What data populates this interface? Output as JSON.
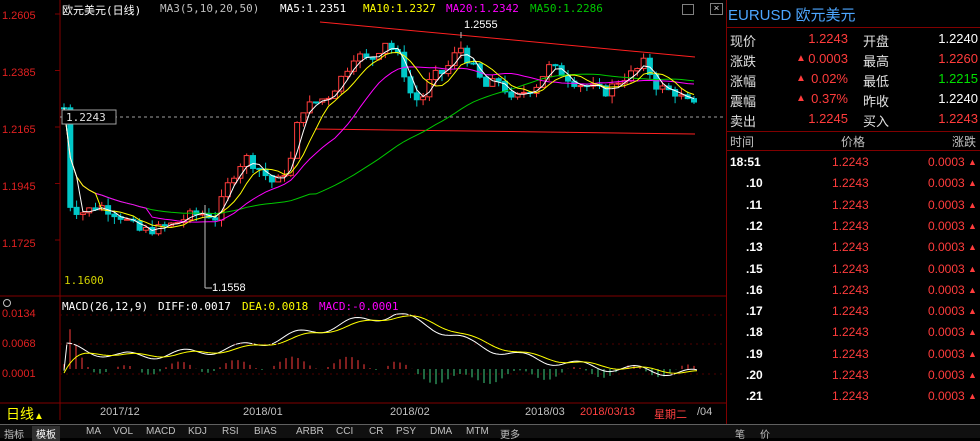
{
  "main_chart": {
    "title": "欧元美元(日线)",
    "ma3": "MA3(5,10,20,50)",
    "ma5": "MA5:1.2351",
    "ma10": "MA10:1.2327",
    "ma20": "MA20:1.2342",
    "ma50": "MA50:1.2286",
    "current_price_tag": "1.2243",
    "high_marker": "1.2555",
    "low_marker": "1.1558",
    "base_label": "1.1600",
    "y_ticks": [
      "1.2605",
      "1.2385",
      "1.2165",
      "1.1945",
      "1.1725"
    ]
  },
  "macd": {
    "header": "MACD(26,12,9)",
    "diff": "DIFF:0.0017",
    "dea": "DEA:0.0018",
    "macd": "MACD:-0.0001",
    "y_ticks": [
      "0.0134",
      "0.0068",
      "0.0001"
    ]
  },
  "x_axis": {
    "dates": [
      "2017/12",
      "2018/01",
      "2018/02",
      "2018/03"
    ],
    "cursor_date": "2018/03/13",
    "weekday": "星期二",
    "tail": "/04"
  },
  "bottom": {
    "period": "日线",
    "period_arrow": "▲",
    "tabs": [
      "指标",
      "模板",
      "MA",
      "VOL",
      "MACD",
      "KDJ",
      "RSI",
      "BIAS",
      "ARBR",
      "CCI",
      "CR",
      "PSY",
      "DMA",
      "MTM",
      "更多"
    ],
    "right_tabs": [
      "笔",
      "价"
    ]
  },
  "quote": {
    "symbol": "EURUSD 欧元美元",
    "rows": [
      {
        "l1": "现价",
        "v1": "1.2243",
        "l2": "开盘",
        "v2": "1.2240"
      },
      {
        "l1": "涨跌",
        "v1": "0.0003",
        "l2": "最高",
        "v2": "1.2260"
      },
      {
        "l1": "涨幅",
        "v1": "0.02%",
        "l2": "最低",
        "v2": "1.2215"
      },
      {
        "l1": "震幅",
        "v1": "0.37%",
        "l2": "昨收",
        "v2": "1.2240"
      },
      {
        "l1": "卖出",
        "v1": "1.2245",
        "l2": "买入",
        "v2": "1.2243"
      }
    ],
    "ticks_header": {
      "time": "时间",
      "price": "价格",
      "change": "涨跌"
    },
    "ticks": [
      {
        "time": "18:51",
        "price": "1.2243",
        "change": "0.0003"
      },
      {
        "time": ".10",
        "price": "1.2243",
        "change": "0.0003"
      },
      {
        "time": ".11",
        "price": "1.2243",
        "change": "0.0003"
      },
      {
        "time": ".12",
        "price": "1.2243",
        "change": "0.0003"
      },
      {
        "time": ".13",
        "price": "1.2243",
        "change": "0.0003"
      },
      {
        "time": ".15",
        "price": "1.2243",
        "change": "0.0003"
      },
      {
        "time": ".16",
        "price": "1.2243",
        "change": "0.0003"
      },
      {
        "time": ".17",
        "price": "1.2243",
        "change": "0.0003"
      },
      {
        "time": ".18",
        "price": "1.2243",
        "change": "0.0003"
      },
      {
        "time": ".19",
        "price": "1.2243",
        "change": "0.0003"
      },
      {
        "time": ".20",
        "price": "1.2243",
        "change": "0.0003"
      },
      {
        "time": ".21",
        "price": "1.2243",
        "change": "0.0003"
      }
    ]
  },
  "colors": {
    "up": "#ff3c3c",
    "down": "#00c8c8",
    "ma5": "#ffffff",
    "ma10": "#ffff00",
    "ma20": "#ff00ff",
    "ma50": "#00c800"
  }
}
